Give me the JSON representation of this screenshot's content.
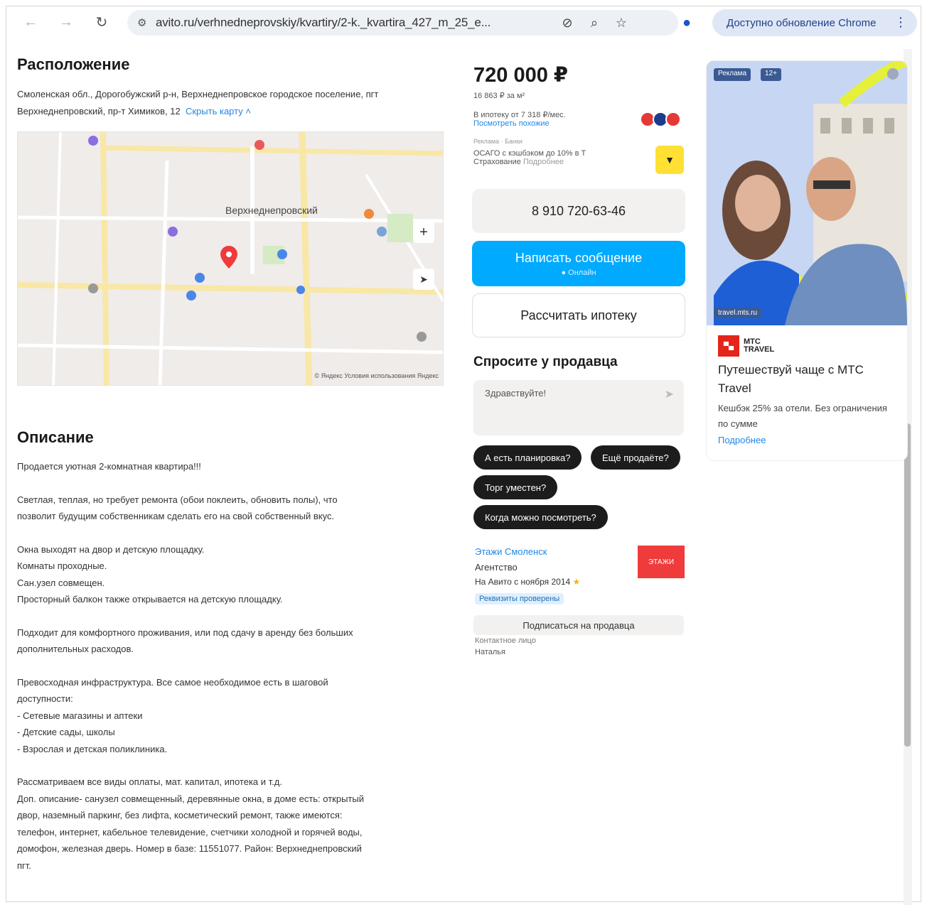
{
  "browser": {
    "url": "avito.ru/verhnedneprovskiy/kvartiry/2-k._kvartira_427_m_25_e...",
    "update_label": "Доступно обновление Chrome",
    "back_icon": "back-arrow-icon",
    "reload_icon": "reload-icon"
  },
  "location": {
    "title": "Расположение",
    "address": "Смоленская обл., Дорогобужский р-н, Верхнеднепровское городское поселение, пгт Верхнеднепровский, пр-т Химиков, 12",
    "hide_map": "Скрыть карту",
    "map_city": "Верхнеднепровский",
    "map_zoom_in": "+",
    "map_footer": "© Яндекс Условия использования  Яндекс"
  },
  "description": {
    "title": "Описание",
    "paragraphs": [
      [
        "Продается уютная 2-комнатная квартира!!!"
      ],
      [
        "Светлая, теплая, но требует ремонта (обои поклеить, обновить полы), что",
        "позволит будущим собственникам сделать его на свой собственный вкус."
      ],
      [
        "Окна выходят на двор и детскую площадку.",
        "Комнаты проходные.",
        "Сан.узел совмещен.",
        "Просторный балкон также открывается на детскую площадку."
      ],
      [
        "Подходит для комфортного проживания, или под сдачу в аренду без больших",
        "дополнительных расходов."
      ],
      [
        "Превосходная инфраструктура. Все самое необходимое есть в шаговой",
        "доступности:",
        "- Сетевые магазины и аптеки",
        "- Детские сады, школы",
        "- Взрослая и детская поликлиника."
      ],
      [
        "Рассматриваем все виды оплаты, мат. капитал, ипотека и т.д.",
        "Доп. описание- санузел совмещенный, деревянные окна, в доме есть: открытый",
        "двор, наземный паркинг, без лифта, косметический ремонт, также имеются:",
        "телефон, интернет, кабельное телевидение, счетчики холодной и горячей воды,",
        "домофон, железная дверь. Номер в базе: 11551077. Район: Верхнеднепровский",
        "пгт."
      ]
    ]
  },
  "offer": {
    "price": "720 000 ₽",
    "price_per_m2": "16 863 ₽ за м²",
    "mortgage": "В ипотеку от 7 318 ₽/мес.",
    "mortgage_link": "Посмотреть похожие",
    "bank_label": "Реклама · Банки",
    "osago": "ОСАГО с кэшбэком до 10% в Т",
    "insurance": "Страхование",
    "insurance_link": "Подробнее",
    "phone": "8 910 720-63-46",
    "message_btn": "Написать сообщение",
    "online": "● Онлайн",
    "mortgage_btn": "Рассчитать ипотеку"
  },
  "ask": {
    "title": "Спросите у продавца",
    "placeholder": "Здравствуйте!",
    "chips": [
      "А есть планировка?",
      "Ещё продаёте?",
      "Торг уместен?",
      "Когда можно посмотреть?"
    ]
  },
  "seller": {
    "name": "Этажи Смоленск",
    "type": "Агентство",
    "since": "На Авито с ноября 2014",
    "verified": "Реквизиты проверены",
    "logo_text": "ЭТАЖИ",
    "subscribe": "Подписаться на продавца",
    "contact_label": "Контактное лицо",
    "contact_name": "Наталья"
  },
  "ad": {
    "badge_ad": "Реклама",
    "badge_age": "12+",
    "domain": "travel.mts.ru",
    "brand_line1": "МТС",
    "brand_line2": "TRAVEL",
    "title": "Путешествуй чаще с МТС Travel",
    "text": "Кешбэк 25% за отели. Без ограничения по сумме",
    "more": "Подробнее"
  },
  "colors": {
    "accent": "#00aaff",
    "link": "#1e88e5",
    "chip": "#1c1c1c"
  }
}
